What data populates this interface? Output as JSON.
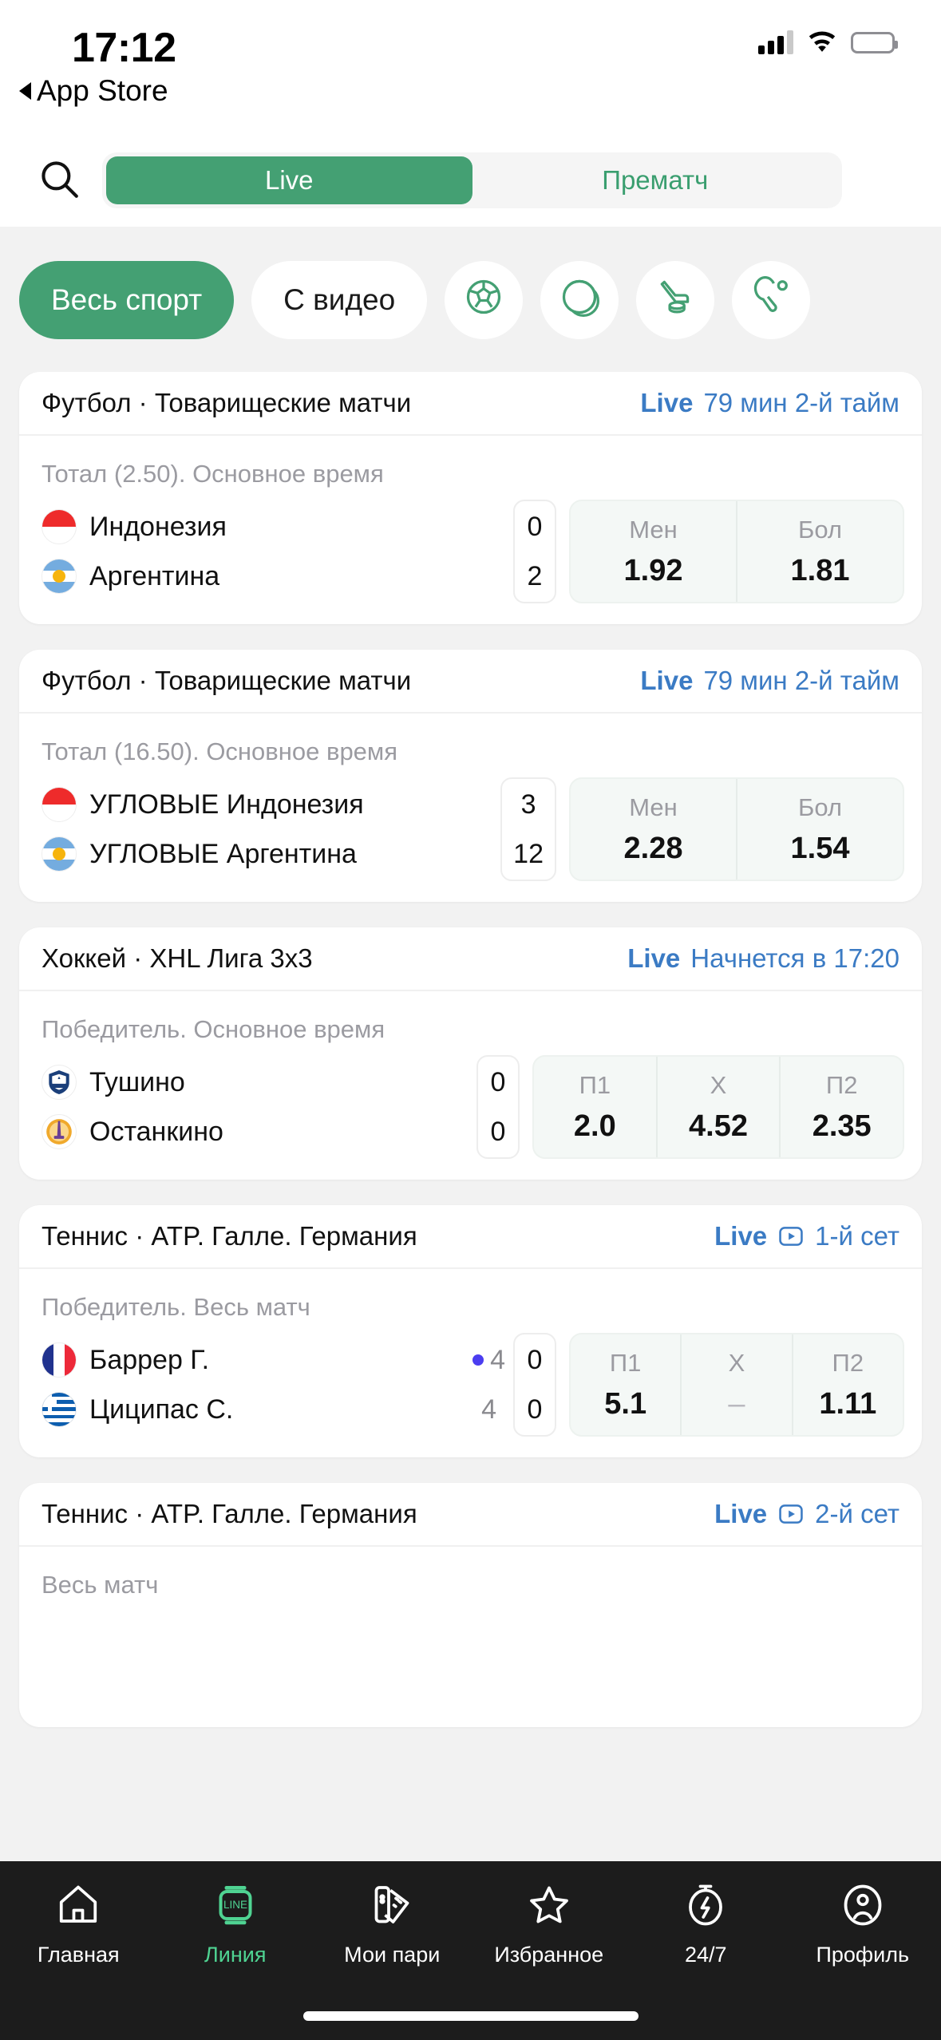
{
  "status_bar": {
    "time": "17:12",
    "back_label": "App Store",
    "icons": [
      "cellular-icon",
      "wifi-icon",
      "battery-icon"
    ]
  },
  "topbar": {
    "search_icon": "search-icon",
    "tabs": [
      {
        "label": "Live",
        "active": true
      },
      {
        "label": "Прематч",
        "active": false
      }
    ]
  },
  "filters": {
    "chips": [
      {
        "label": "Весь спорт",
        "active": true,
        "type": "text"
      },
      {
        "label": "С видео",
        "active": false,
        "type": "text"
      },
      {
        "label": "",
        "icon": "soccer-ball-icon",
        "active": false,
        "type": "icon"
      },
      {
        "label": "",
        "icon": "tennis-ball-icon",
        "active": false,
        "type": "icon"
      },
      {
        "label": "",
        "icon": "hockey-stick-puck-icon",
        "active": false,
        "type": "icon"
      },
      {
        "label": "",
        "icon": "table-tennis-paddle-icon",
        "active": false,
        "type": "icon"
      }
    ]
  },
  "matches": [
    {
      "sport_league": "Футбол · Товарищеские матчи",
      "live_label": "Live",
      "has_video": false,
      "status": "79 мин 2-й тайм",
      "market": "Тотал (2.50). Основное время",
      "teams": [
        {
          "name": "Индонезия",
          "flag": "indonesia-flag",
          "score": "0",
          "serving": false
        },
        {
          "name": "Аргентина",
          "flag": "argentina-flag",
          "score": "2",
          "serving": false
        }
      ],
      "odds": [
        {
          "label": "Мен",
          "value": "1.92"
        },
        {
          "label": "Бол",
          "value": "1.81"
        }
      ]
    },
    {
      "sport_league": "Футбол · Товарищеские матчи",
      "live_label": "Live",
      "has_video": false,
      "status": "79 мин 2-й тайм",
      "market": "Тотал (16.50). Основное время",
      "teams": [
        {
          "name": "УГЛОВЫЕ Индонезия",
          "flag": "indonesia-flag",
          "score": "3",
          "serving": false
        },
        {
          "name": "УГЛОВЫЕ Аргентина",
          "flag": "argentina-flag",
          "score": "12",
          "serving": false
        }
      ],
      "odds": [
        {
          "label": "Мен",
          "value": "2.28"
        },
        {
          "label": "Бол",
          "value": "1.54"
        }
      ]
    },
    {
      "sport_league": "Хоккей · XHL Лига 3х3",
      "live_label": "Live",
      "has_video": false,
      "status": "Начнется в 17:20",
      "market": "Победитель. Основное время",
      "teams": [
        {
          "name": "Тушино",
          "flag": "tushino-club-logo",
          "score": "0",
          "serving": false
        },
        {
          "name": "Останкино",
          "flag": "ostankino-club-logo",
          "score": "0",
          "serving": false
        }
      ],
      "odds": [
        {
          "label": "П1",
          "value": "2.0"
        },
        {
          "label": "Х",
          "value": "4.52"
        },
        {
          "label": "П2",
          "value": "2.35"
        }
      ]
    },
    {
      "sport_league": "Теннис · ATP. Галле. Германия",
      "live_label": "Live",
      "has_video": true,
      "status": "1-й сет",
      "market": "Победитель. Весь матч",
      "teams": [
        {
          "name": "Баррер Г.",
          "flag": "france-flag",
          "sets": "4",
          "score": "0",
          "serving": true
        },
        {
          "name": "Циципас С.",
          "flag": "greece-flag",
          "sets": "4",
          "score": "0",
          "serving": false
        }
      ],
      "odds": [
        {
          "label": "П1",
          "value": "5.1"
        },
        {
          "label": "Х",
          "value": "–"
        },
        {
          "label": "П2",
          "value": "1.11"
        }
      ]
    },
    {
      "sport_league": "Теннис · ATP. Галле. Германия",
      "live_label": "Live",
      "has_video": true,
      "status": "2-й сет",
      "market": "Весь матч",
      "teams": [],
      "odds": []
    }
  ],
  "tabbar": {
    "items": [
      {
        "label": "Главная",
        "icon": "home-icon",
        "active": false
      },
      {
        "label": "Линия",
        "icon": "line-badge-icon",
        "active": true
      },
      {
        "label": "Мои пари",
        "icon": "bet-tickets-icon",
        "active": false
      },
      {
        "label": "Избранное",
        "icon": "star-icon",
        "active": false
      },
      {
        "label": "24/7",
        "icon": "stopwatch-icon",
        "active": false
      },
      {
        "label": "Профиль",
        "icon": "user-circle-icon",
        "active": false
      }
    ]
  },
  "colors": {
    "brand_green": "#44a073",
    "live_blue": "#3b7bc4",
    "tab_active_green": "#4fd392",
    "page_bg": "#f2f2f2",
    "card_bg": "#ffffff",
    "odds_bg": "#f4f8f6"
  }
}
